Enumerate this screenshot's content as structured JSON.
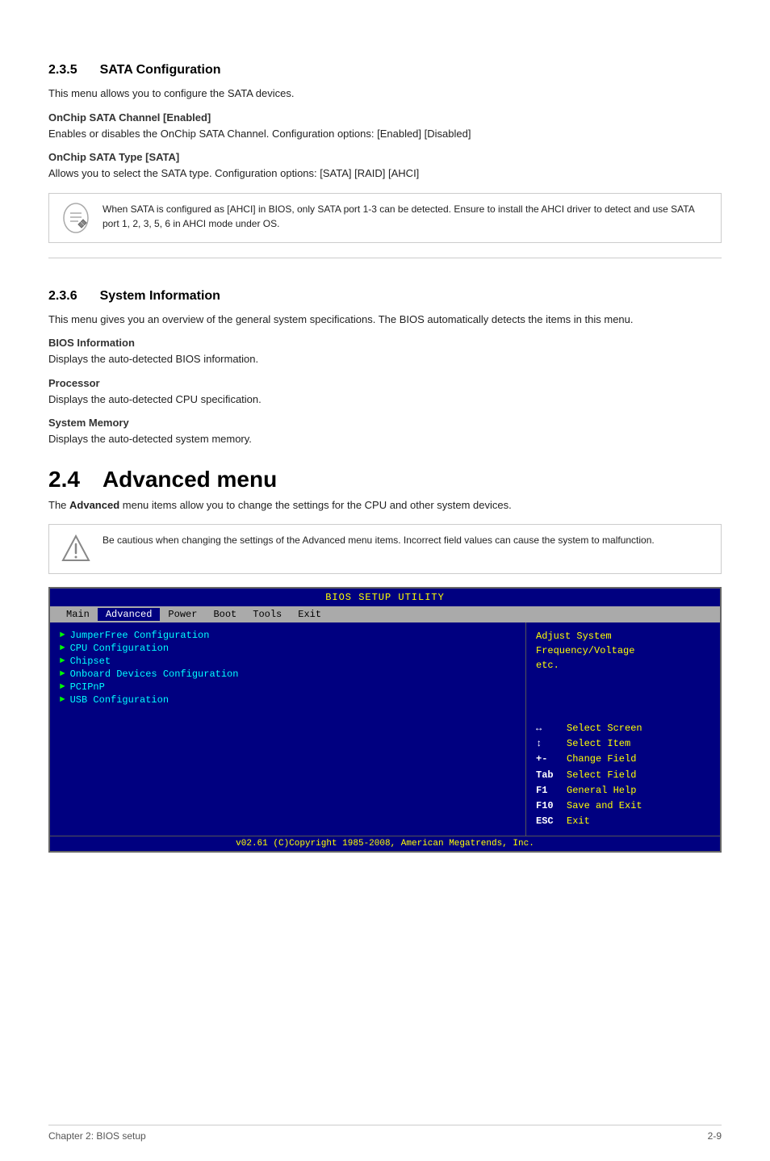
{
  "sections": [
    {
      "id": "2.3.5",
      "title": "SATA Configuration",
      "intro": "This menu allows you to configure the SATA devices.",
      "subsections": [
        {
          "title": "OnChip SATA Channel [Enabled]",
          "body": "Enables or disables the OnChip SATA Channel. Configuration options: [Enabled] [Disabled]"
        },
        {
          "title": "OnChip SATA Type [SATA]",
          "body": "Allows you to select the SATA type. Configuration options: [SATA] [RAID] [AHCI]"
        }
      ],
      "note": {
        "type": "note",
        "text": "When SATA is configured as [AHCI] in BIOS, only SATA port 1-3 can be detected. Ensure to install the AHCI driver to detect and use SATA port 1, 2, 3, 5, 6 in AHCI mode under OS."
      }
    },
    {
      "id": "2.3.6",
      "title": "System Information",
      "intro": "This menu gives you an overview of the general system specifications. The BIOS automatically detects the items in this menu.",
      "subsections": [
        {
          "title": "BIOS Information",
          "body": "Displays the auto-detected BIOS information."
        },
        {
          "title": "Processor",
          "body": "Displays the auto-detected CPU specification."
        },
        {
          "title": "System Memory",
          "body": "Displays the auto-detected system memory."
        }
      ]
    }
  ],
  "advanced_section": {
    "id": "2.4",
    "title": "Advanced menu",
    "intro_parts": [
      "The ",
      "Advanced",
      " menu items allow you to change the settings for the CPU and other system devices."
    ],
    "warning": {
      "text": "Be cautious when changing the settings of the Advanced menu items. Incorrect field values can cause the system to malfunction."
    }
  },
  "bios": {
    "title": "BIOS SETUP UTILITY",
    "menu_items": [
      {
        "label": "Main",
        "active": false
      },
      {
        "label": "Advanced",
        "active": true
      },
      {
        "label": "Power",
        "active": false
      },
      {
        "label": "Boot",
        "active": false
      },
      {
        "label": "Tools",
        "active": false
      },
      {
        "label": "Exit",
        "active": false
      }
    ],
    "entries": [
      "JumperFree Configuration",
      "CPU Configuration",
      "Chipset",
      "Onboard Devices Configuration",
      "PCIPnP",
      "USB Configuration"
    ],
    "right_top": "Adjust System\nFrequency/Voltage\netc.",
    "keys": [
      {
        "key": "↔",
        "desc": "Select Screen"
      },
      {
        "key": "↕",
        "desc": "Select Item"
      },
      {
        "key": "+-",
        "desc": "Change Field"
      },
      {
        "key": "Tab",
        "desc": "Select Field"
      },
      {
        "key": "F1",
        "desc": "General Help"
      },
      {
        "key": "F10",
        "desc": "Save and Exit"
      },
      {
        "key": "ESC",
        "desc": "Exit"
      }
    ],
    "footer": "v02.61  (C)Copyright 1985-2008, American Megatrends, Inc."
  },
  "footer": {
    "left": "Chapter 2: BIOS setup",
    "right": "2-9"
  }
}
